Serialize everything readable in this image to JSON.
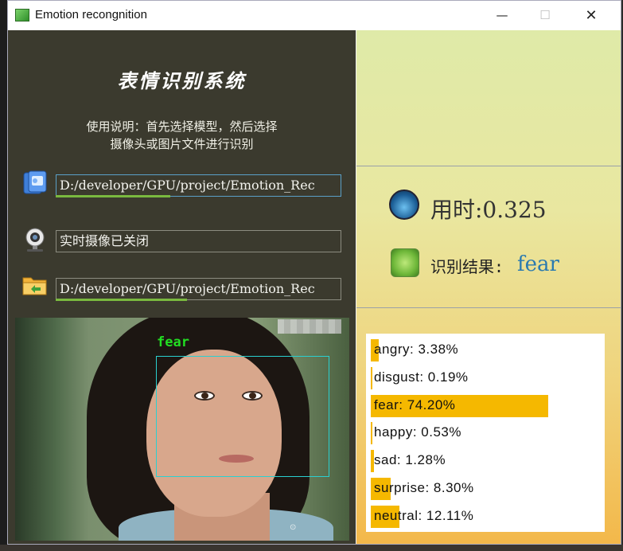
{
  "window": {
    "title": "Emotion recongnition",
    "minimize_glyph": "—",
    "maximize_glyph": "☐",
    "close_glyph": "✕"
  },
  "left": {
    "app_title": "表情识别系统",
    "instructions_line1": "使用说明：首先选择模型，然后选择",
    "instructions_line2": "摄像头或图片文件进行识别",
    "model_path": "D:/developer/GPU/project/Emotion_Rec",
    "camera_status": "实时摄像已关闭",
    "image_path": "D:/developer/GPU/project/Emotion_Rec",
    "model_progress": 0.4,
    "image_progress": 0.46,
    "detection_label": "fear"
  },
  "right": {
    "time_label": "用时:0.325",
    "result_label": "识别结果:",
    "result_value": "fear"
  },
  "chart_data": {
    "type": "bar",
    "categories": [
      "angry",
      "disgust",
      "fear",
      "happy",
      "sad",
      "surprise",
      "neutral"
    ],
    "values": [
      3.38,
      0.19,
      74.2,
      0.53,
      1.28,
      8.3,
      12.11
    ],
    "labels": [
      "angry: 3.38%",
      "disgust: 0.19%",
      "fear: 74.20%",
      "happy: 0.53%",
      "sad: 1.28%",
      "surprise: 8.30%",
      "neutral: 12.11%"
    ],
    "bar_color": "#f5b800"
  },
  "icons": {
    "model": "file-open-icon",
    "camera": "webcam-icon",
    "image": "folder-open-icon",
    "time": "speedometer-icon",
    "result": "radar-icon"
  }
}
